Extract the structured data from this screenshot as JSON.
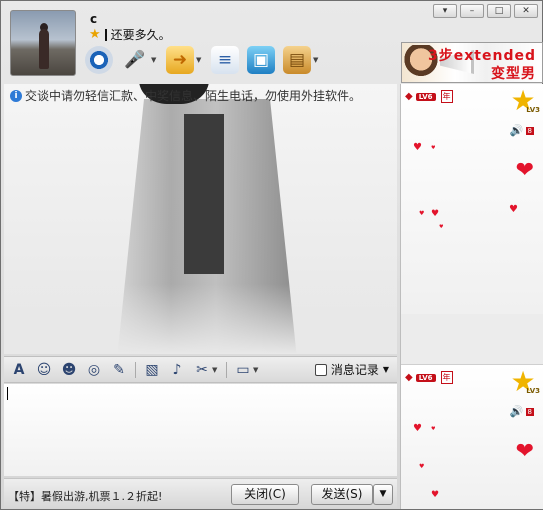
{
  "window": {
    "controls": [
      {
        "name": "menu-dropdown",
        "glyph": "▾"
      },
      {
        "name": "minimize",
        "glyph": "–"
      },
      {
        "name": "maximize",
        "glyph": "□"
      },
      {
        "name": "close",
        "glyph": "✕"
      }
    ]
  },
  "header": {
    "contact_name": "c",
    "status_text": "还要多久。",
    "toolbar_icons": [
      "video-call-icon",
      "voice-call-icon",
      "file-transfer-icon",
      "message-icon",
      "remote-desktop-icon",
      "app-box-icon"
    ]
  },
  "ad": {
    "line1": "3步extended",
    "line2": "变型男"
  },
  "chat": {
    "notice": "交谈中请勿轻信汇款、中奖信息、陌生电话，勿使用外挂软件。"
  },
  "input_toolbar": {
    "history_label": "消息记录"
  },
  "bottom": {
    "promo": "【特】暑假出游,机票１.２折起!",
    "close_label": "关闭(C)",
    "send_label": "发送(S)"
  },
  "sidebar": {
    "level_label": "LV6",
    "year_label": "年",
    "star_level": "LV3",
    "speaker_badge": "8"
  },
  "colors": {
    "accent_red": "#c40f19",
    "star_gold": "#f0b400",
    "info_blue": "#2e7ad6"
  }
}
